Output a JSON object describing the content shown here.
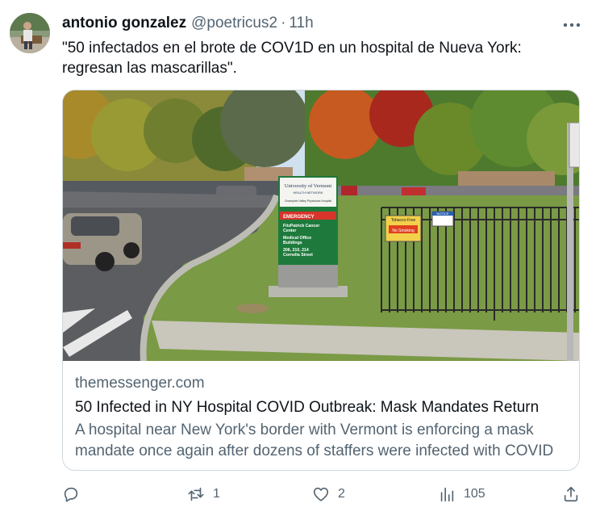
{
  "tweet": {
    "author_name": "antonio gonzalez",
    "handle": "@poetricus2",
    "separator": "·",
    "time": "11h",
    "text": "\"50 infectados en el brote de COV1D en un hospital de Nueva York: regresan las mascarillas\"."
  },
  "card": {
    "domain": "themessenger.com",
    "title": "50 Infected in NY Hospital COVID Outbreak: Mask Mandates Return",
    "description": "A hospital near New York's border with Vermont is enforcing a mask mandate once again after dozens of staffers were infected with COVID",
    "image": {
      "sign_org": "University of Vermont",
      "sign_network": "HEALTH NETWORK",
      "sign_hospital": "Champlain Valley Physicians Hospital",
      "sign_emergency": "EMERGENCY",
      "sign_line1": "FitzPatrick Cancer",
      "sign_line2": "Center",
      "sign_line3": "Medical Office",
      "sign_line4": "Buildings",
      "sign_line5": "206, 210, 214",
      "sign_line6": "Cornelia Street",
      "notice_sign": "NOTICE",
      "tobacco_sign": "Tobacco-Free",
      "no_smoking_sign": "No Smoking"
    }
  },
  "actions": {
    "replies_icon": "reply-icon",
    "retweet_icon": "retweet-icon",
    "retweets": "1",
    "like_icon": "heart-icon",
    "likes": "2",
    "views_icon": "views-icon",
    "views": "105",
    "share_icon": "share-icon"
  },
  "colors": {
    "text_primary": "#0f1419",
    "text_secondary": "#536471",
    "border": "#cfd9de",
    "sign_green": "#1e7a3c",
    "sign_red": "#d9342b"
  }
}
